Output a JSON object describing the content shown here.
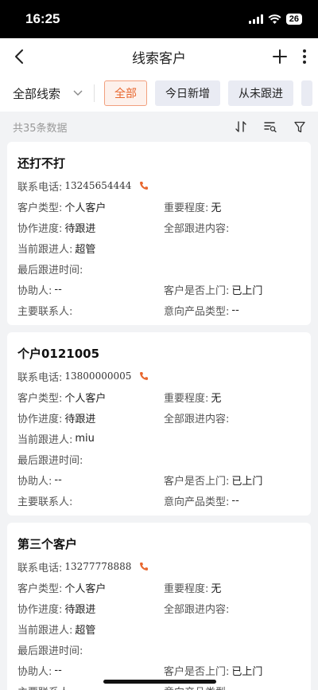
{
  "status_bar": {
    "time": "16:25",
    "battery": "26"
  },
  "nav": {
    "title": "线索客户"
  },
  "filter": {
    "dropdown_label": "全部线索",
    "chips": [
      "全部",
      "今日新增",
      "从未跟进"
    ]
  },
  "summary": {
    "count_text": "共35条数据"
  },
  "labels": {
    "phone": "联系电话:",
    "customer_type": "客户类型:",
    "importance": "重要程度:",
    "progress": "协作进度:",
    "all_follow": "全部跟进内容:",
    "current_follower": "当前跟进人:",
    "last_follow_time": "最后跟进时间:",
    "assistant": "协助人:",
    "visited": "客户是否上门:",
    "main_contact": "主要联系人:",
    "product_type": "意向产品类型:"
  },
  "cards": [
    {
      "name": "还打不打",
      "phone": "13245654444",
      "customer_type": "个人客户",
      "importance": "无",
      "progress": "待跟进",
      "all_follow": "",
      "current_follower": "超管",
      "last_follow_time": "",
      "assistant": "--",
      "visited": "已上门",
      "main_contact": "",
      "product_type": "--"
    },
    {
      "name": "个户0121005",
      "phone": "13800000005",
      "customer_type": "个人客户",
      "importance": "无",
      "progress": "待跟进",
      "all_follow": "",
      "current_follower": "miu",
      "last_follow_time": "",
      "assistant": "--",
      "visited": "已上门",
      "main_contact": "",
      "product_type": "--"
    },
    {
      "name": "第三个客户",
      "phone": "13277778888",
      "customer_type": "个人客户",
      "importance": "无",
      "progress": "待跟进",
      "all_follow": "",
      "current_follower": "超管",
      "last_follow_time": "",
      "assistant": "--",
      "visited": "已上门",
      "main_contact": "",
      "product_type": ""
    }
  ],
  "colors": {
    "accent": "#e8672e",
    "chip_bg": "#e9ebf3",
    "page_bg": "#f2f3f5"
  }
}
